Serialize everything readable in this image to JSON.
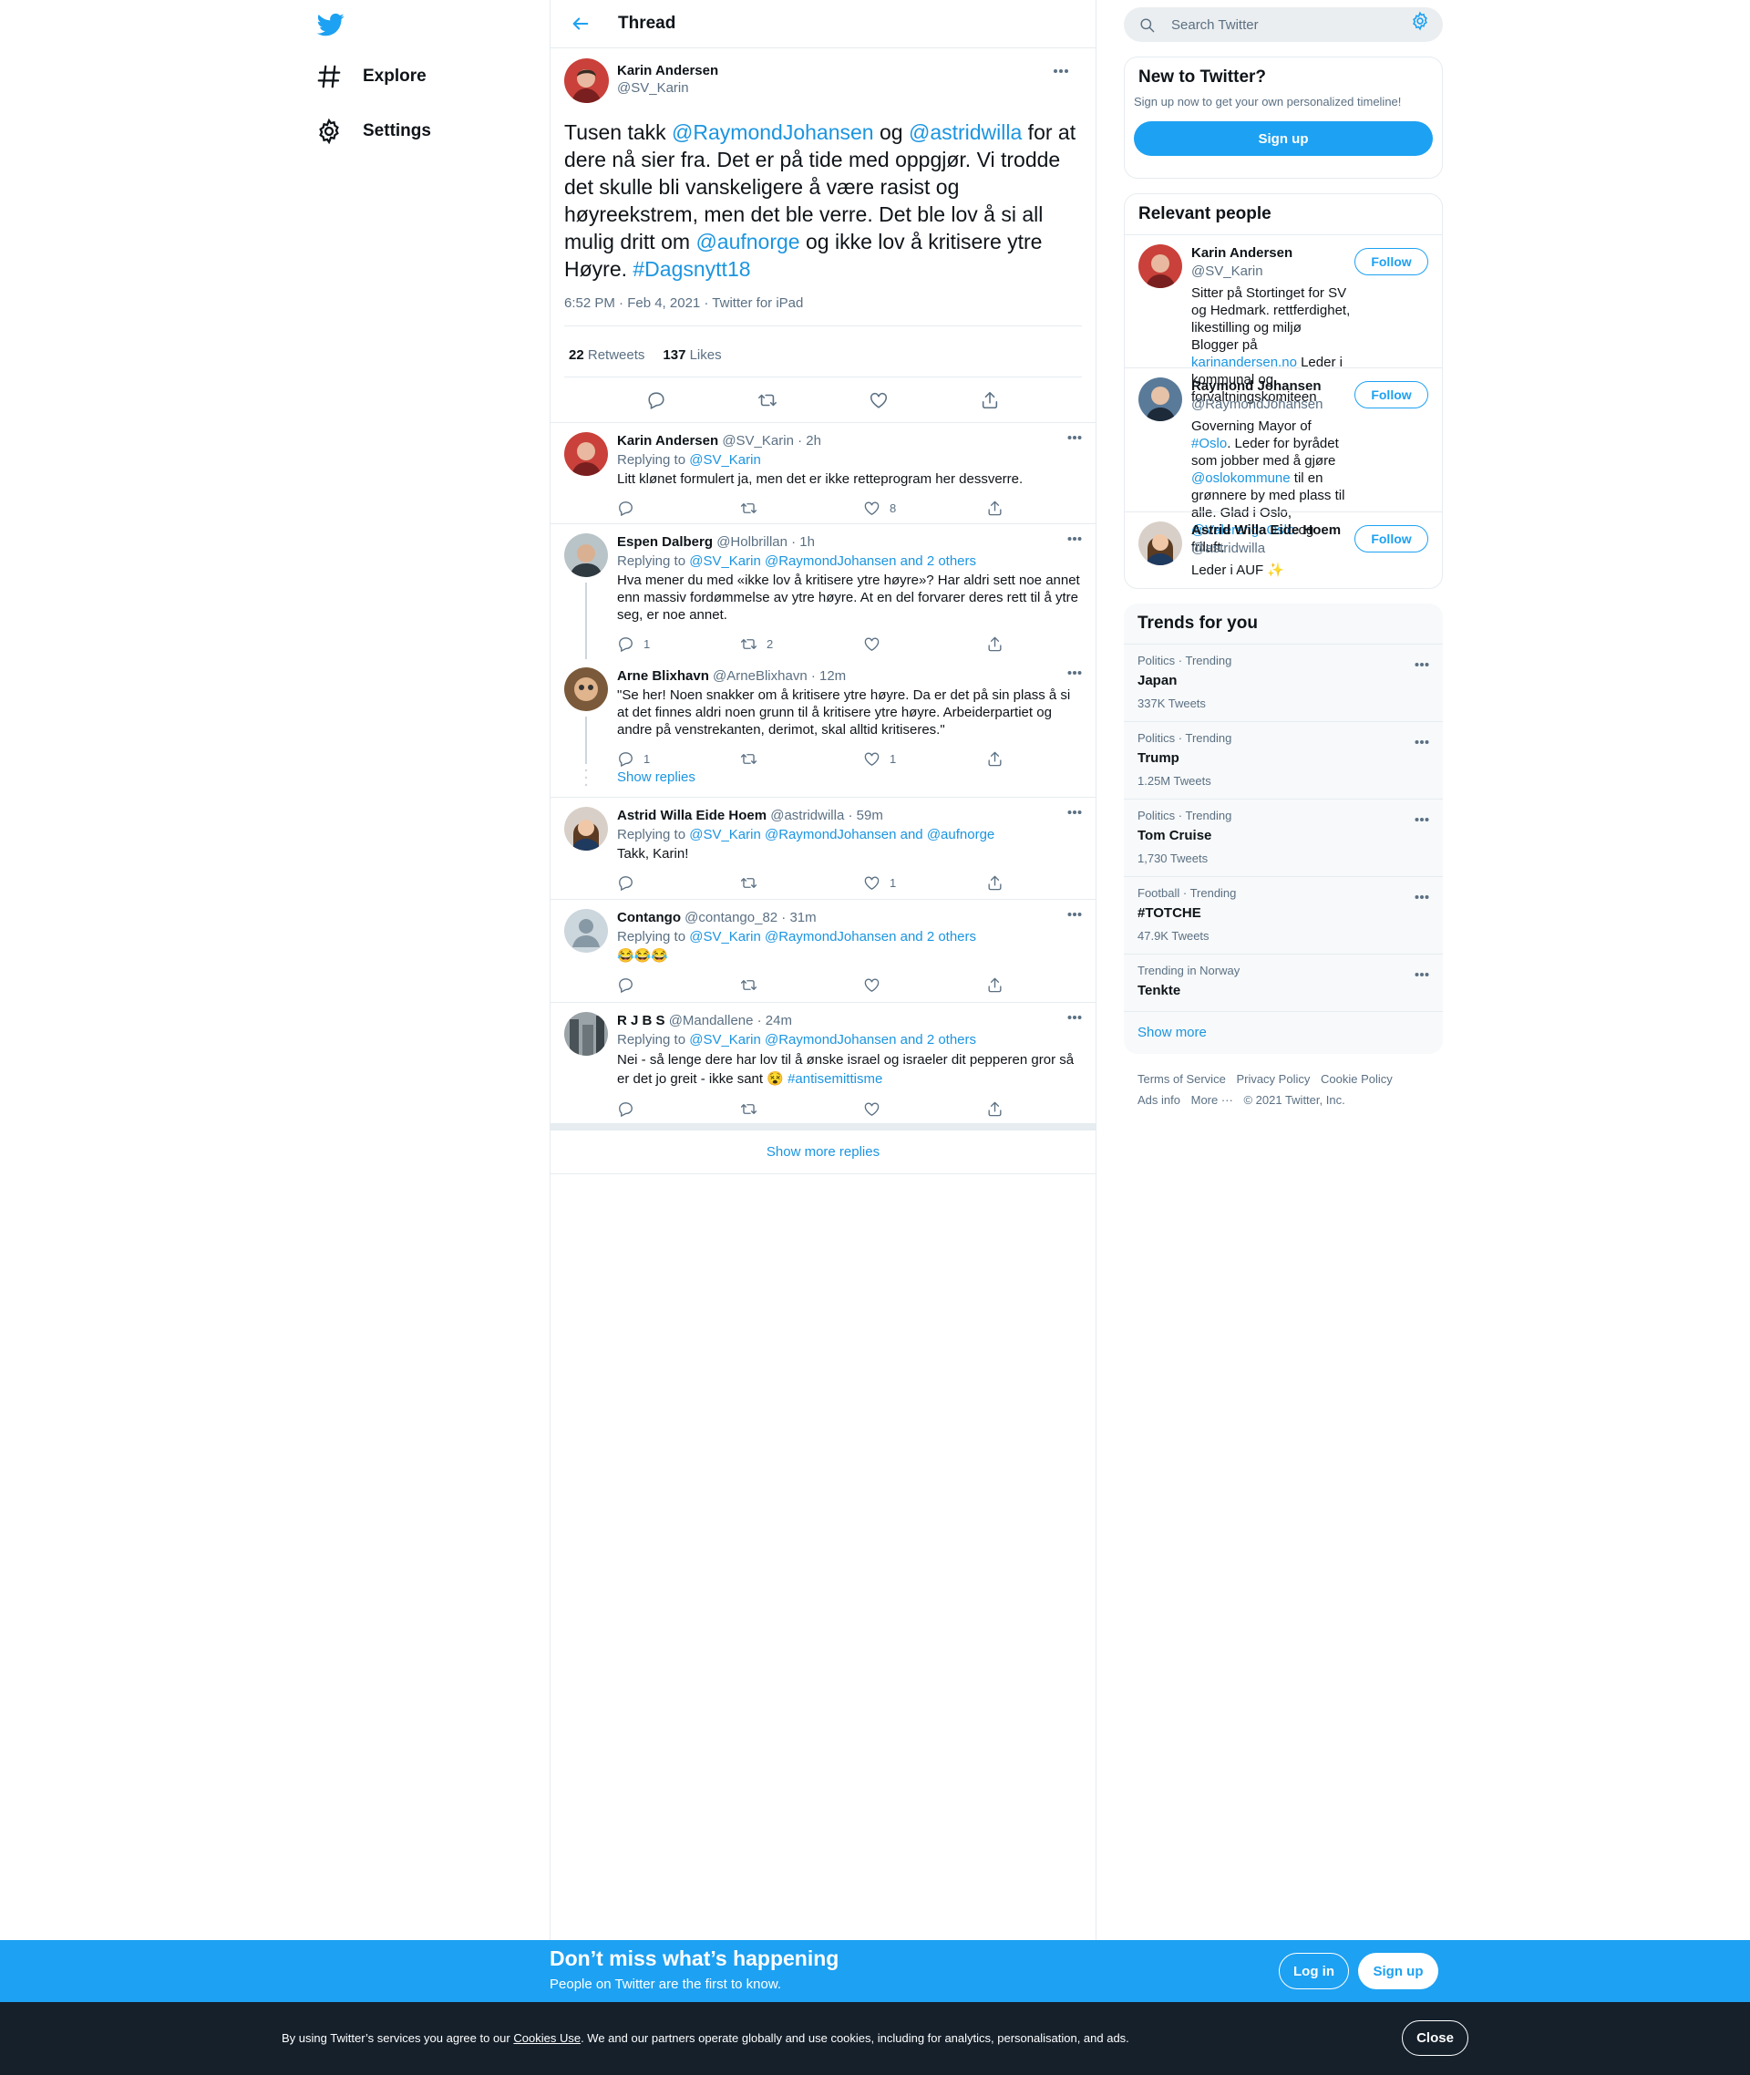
{
  "nav": {
    "explore_label": "Explore",
    "settings_label": "Settings"
  },
  "header": {
    "title": "Thread"
  },
  "main_tweet": {
    "name": "Karin Andersen",
    "handle": "@SV_Karin",
    "text_parts": {
      "p1": "Tusen takk ",
      "m1": "@RaymondJohansen",
      "p2": " og ",
      "m2": "@astridwilla",
      "p3": " for at dere nå sier fra. Det er på tide med oppgjør. Vi trodde det skulle bli vanskeligere å være rasist og høyreekstrem, men det ble verre. Det ble lov å si all mulig dritt om ",
      "m3": "@aufnorge",
      "p4": " og ikke lov å kritisere ytre Høyre. ",
      "m4": "#Dagsnytt18"
    },
    "meta": "6:52 PM · Feb 4, 2021 · Twitter for iPad",
    "retweets": "22",
    "retweets_label": "Retweets",
    "likes": "137",
    "likes_label": "Likes"
  },
  "replies": [
    {
      "name": "Karin Andersen",
      "handle": "@SV_Karin · 2h",
      "replying_label": "Replying to ",
      "replying_to": "@SV_Karin",
      "text": "Litt klønet formulert ja, men det er ikke retteprogram her dessverre.",
      "replies": "",
      "retweets": "",
      "likes": "8"
    },
    {
      "name": "Espen Dalberg",
      "handle": "@Holbrillan · 1h",
      "replying_label": "Replying to ",
      "replying_to": "@SV_Karin @RaymondJohansen and 2 others",
      "text": "Hva mener du med «ikke lov å kritisere ytre høyre»? Har aldri sett noe annet enn massiv fordømmelse av ytre høyre. At en del forvarer deres rett til å ytre seg, er noe annet.",
      "replies": "1",
      "retweets": "2",
      "likes": ""
    },
    {
      "name": "Arne Blixhavn",
      "handle": "@ArneBlixhavn · 12m",
      "text": "\"Se her! Noen snakker om å kritisere ytre høyre. Da er det på sin plass å si at det finnes aldri noen grunn til å kritisere ytre høyre. Arbeiderpartiet og andre på venstrekanten, derimot, skal alltid kritiseres.\"",
      "replies": "1",
      "retweets": "",
      "likes": "1"
    },
    {
      "name": "Astrid Willa Eide Hoem",
      "handle": "@astridwilla · 59m",
      "replying_label": "Replying to ",
      "replying_to": "@SV_Karin @RaymondJohansen and @aufnorge",
      "text": "Takk, Karin!",
      "replies": "",
      "retweets": "",
      "likes": "1"
    },
    {
      "name": "Contango",
      "handle": "@contango_82 · 31m",
      "replying_label": "Replying to ",
      "replying_to": "@SV_Karin @RaymondJohansen and 2 others",
      "text": "😂😂😂",
      "replies": "",
      "retweets": "",
      "likes": ""
    },
    {
      "name": "R J B S",
      "handle": "@Mandallene · 24m",
      "replying_label": "Replying to ",
      "replying_to": "@SV_Karin @RaymondJohansen and 2 others",
      "text": "Nei - så lenge dere har lov til å ønske israel og israeler dit pepperen gror så er det jo greit - ikke sant 😵 ",
      "hashtag": "#antisemittisme",
      "replies": "",
      "retweets": "",
      "likes": ""
    }
  ],
  "show_replies_label": "Show replies",
  "show_more_replies_label": "Show more replies",
  "search": {
    "placeholder": "Search Twitter"
  },
  "new_to_twitter": {
    "title": "New to Twitter?",
    "subtitle": "Sign up now to get your own personalized timeline!",
    "signup_label": "Sign up"
  },
  "relevant_people": {
    "title": "Relevant people",
    "follow_label": "Follow",
    "people": [
      {
        "name": "Karin Andersen",
        "handle": "@SV_Karin",
        "bio1": "Sitter på Stortinget for SV og Hedmark. rettferdighet, likestilling og miljø Blogger på ",
        "bio_link": "karinandersen.no",
        "bio2": " Leder i kommunal og forvaltningskomiteen"
      },
      {
        "name": "Raymond Johansen",
        "handle": "@RaymondJohansen",
        "bio1": "Governing Mayor of ",
        "bio_link": "#Oslo",
        "bio2": ". Leder for byrådet som jobber med å gjøre ",
        "bio_link2": "@oslokommune",
        "bio3": " til en grønnere by med plass til alle. Glad i Oslo, ",
        "bio_link3": "@ValerengaOslo",
        "bio4": " og friluft."
      },
      {
        "name": "Astrid Willa Eide Hoem",
        "handle": "@astridwilla",
        "bio1": "Leder i AUF ✨"
      }
    ]
  },
  "trends": {
    "title": "Trends for you",
    "items": [
      {
        "category": "Politics · Trending",
        "name": "Japan",
        "count": "337K Tweets"
      },
      {
        "category": "Politics · Trending",
        "name": "Trump",
        "count": "1.25M Tweets"
      },
      {
        "category": "Politics · Trending",
        "name": "Tom Cruise",
        "count": "1,730 Tweets"
      },
      {
        "category": "Football · Trending",
        "name": "#TOTCHE",
        "count": "47.9K Tweets"
      },
      {
        "category": "Trending in Norway",
        "name": "Tenkte",
        "count": ""
      }
    ],
    "show_more_label": "Show more"
  },
  "footer": {
    "links": [
      "Terms of Service",
      "Privacy Policy",
      "Cookie Policy",
      "Ads info",
      "More ···",
      "© 2021 Twitter, Inc."
    ]
  },
  "banner": {
    "title": "Don’t miss what’s happening",
    "subtitle": "People on Twitter are the first to know.",
    "login_label": "Log in",
    "signup_label": "Sign up"
  },
  "cookie": {
    "text_before": "By using Twitter’s services you agree to our ",
    "link": "Cookies Use",
    "text_after": ". We and our partners operate globally and use cookies, including for analytics, personalisation, and ads.",
    "close_label": "Close"
  },
  "colors": {
    "brand": "#1da1f2",
    "link": "#1b95e0",
    "secondary_text": "#5b7083"
  }
}
